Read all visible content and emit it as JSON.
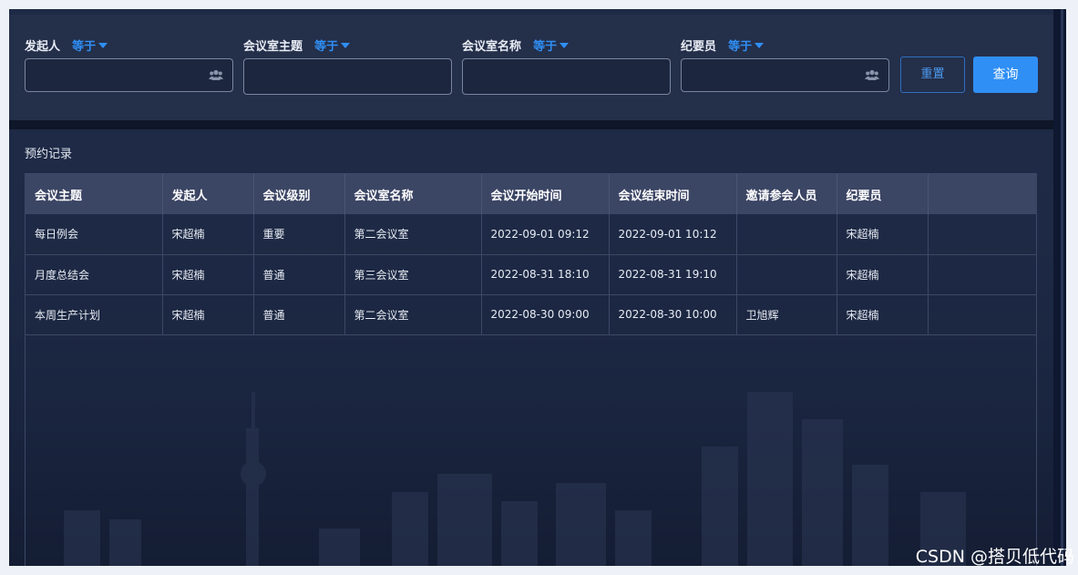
{
  "filters": [
    {
      "label": "发起人",
      "operator": "等于",
      "value": "",
      "has_people_icon": true
    },
    {
      "label": "会议室主题",
      "operator": "等于",
      "value": "",
      "has_people_icon": false
    },
    {
      "label": "会议室名称",
      "operator": "等于",
      "value": "",
      "has_people_icon": false
    },
    {
      "label": "纪要员",
      "operator": "等于",
      "value": "",
      "has_people_icon": true
    }
  ],
  "buttons": {
    "reset": "重置",
    "query": "查询"
  },
  "section_title": "预约记录",
  "table": {
    "columns": [
      "会议主题",
      "发起人",
      "会议级别",
      "会议室名称",
      "会议开始时间",
      "会议结束时间",
      "邀请参会人员",
      "纪要员",
      ""
    ],
    "rows": [
      [
        "每日例会",
        "宋超楠",
        "重要",
        "第二会议室",
        "2022-09-01 09:12",
        "2022-09-01 10:12",
        "",
        "宋超楠",
        ""
      ],
      [
        "月度总结会",
        "宋超楠",
        "普通",
        "第三会议室",
        "2022-08-31 18:10",
        "2022-08-31 19:10",
        "",
        "宋超楠",
        ""
      ],
      [
        "本周生产计划",
        "宋超楠",
        "普通",
        "第二会议室",
        "2022-08-30 09:00",
        "2022-08-30 10:00",
        "卫旭辉",
        "宋超楠",
        ""
      ]
    ]
  },
  "icons": {
    "people": "people-icon",
    "caret": "caret-down-icon"
  },
  "colors": {
    "accent": "#2f8ff5",
    "header_bg": "#3b4564",
    "panel_bg": "#1e2a45"
  },
  "watermark": "CSDN @搭贝低代码"
}
